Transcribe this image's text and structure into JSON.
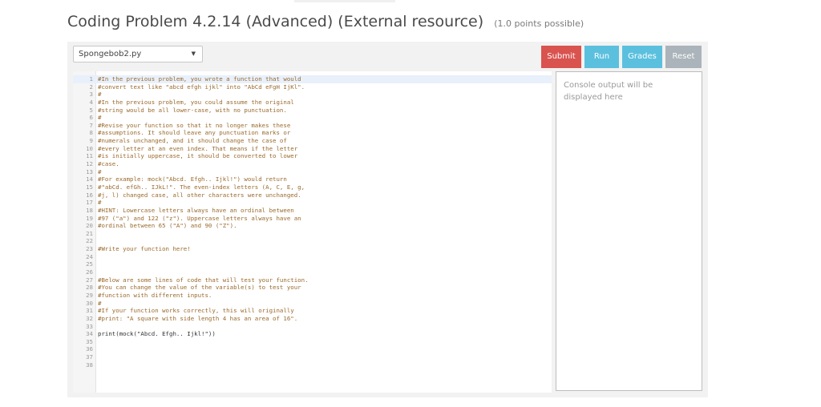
{
  "problem": {
    "title": "Coding Problem 4.2.14 (Advanced) (External resource)",
    "points": "(1.0 points possible)"
  },
  "toolbar": {
    "file_selected": "Spongebob2.py",
    "submit_label": "Submit",
    "run_label": "Run",
    "grades_label": "Grades",
    "reset_label": "Reset"
  },
  "editor": {
    "lines": [
      {
        "n": "1",
        "text": "#In the previous problem, you wrote a function that would"
      },
      {
        "n": "2",
        "text": "#convert text like \"abcd efgh ijkl\" into \"AbCd eFgH IjKl\"."
      },
      {
        "n": "3",
        "text": "#"
      },
      {
        "n": "4",
        "text": "#In the previous problem, you could assume the original"
      },
      {
        "n": "5",
        "text": "#string would be all lower-case, with no punctuation."
      },
      {
        "n": "6",
        "text": "#"
      },
      {
        "n": "7",
        "text": "#Revise your function so that it no longer makes these"
      },
      {
        "n": "8",
        "text": "#assumptions. It should leave any punctuation marks or"
      },
      {
        "n": "9",
        "text": "#numerals unchanged, and it should change the case of"
      },
      {
        "n": "10",
        "text": "#every letter at an even index. That means if the letter"
      },
      {
        "n": "11",
        "text": "#is initially uppercase, it should be converted to lower"
      },
      {
        "n": "12",
        "text": "#case."
      },
      {
        "n": "13",
        "text": "#"
      },
      {
        "n": "14",
        "text": "#For example: mock(\"Abcd. Efgh.. Ijkl!\") would return"
      },
      {
        "n": "15",
        "text": "#\"abCd. efGh.. IJkL!\". The even-index letters (A, C, E, g,"
      },
      {
        "n": "16",
        "text": "#j, l) changed case, all other characters were unchanged."
      },
      {
        "n": "17",
        "text": "#"
      },
      {
        "n": "18",
        "text": "#HINT: Lowercase letters always have an ordinal between"
      },
      {
        "n": "19",
        "text": "#97 (\"a\") and 122 (\"z\"). Uppercase letters always have an"
      },
      {
        "n": "20",
        "text": "#ordinal between 65 (\"A\") and 90 (\"Z\")."
      },
      {
        "n": "21",
        "text": ""
      },
      {
        "n": "22",
        "text": ""
      },
      {
        "n": "23",
        "text": "#Write your function here!"
      },
      {
        "n": "24",
        "text": ""
      },
      {
        "n": "25",
        "text": ""
      },
      {
        "n": "26",
        "text": ""
      },
      {
        "n": "27",
        "text": "#Below are some lines of code that will test your function."
      },
      {
        "n": "28",
        "text": "#You can change the value of the variable(s) to test your"
      },
      {
        "n": "29",
        "text": "#function with different inputs."
      },
      {
        "n": "30",
        "text": "#"
      },
      {
        "n": "31",
        "text": "#If your function works correctly, this will originally"
      },
      {
        "n": "32",
        "text": "#print: \"A square with side length 4 has an area of 16\"."
      },
      {
        "n": "33",
        "text": ""
      },
      {
        "n": "34",
        "text": "print(mock(\"Abcd. Efgh.. Ijkl!\"))"
      },
      {
        "n": "35",
        "text": ""
      },
      {
        "n": "36",
        "text": ""
      },
      {
        "n": "37",
        "text": ""
      },
      {
        "n": "38",
        "text": ""
      }
    ]
  },
  "console": {
    "placeholder": "Console output will be displayed here"
  },
  "colors": {
    "submit": "#d9534f",
    "run": "#5bc0de",
    "grades": "#5bc0de",
    "reset": "#aab4ba",
    "comment": "#9a6a2c"
  },
  "icons": {
    "select_caret": "chevron-down-icon"
  }
}
